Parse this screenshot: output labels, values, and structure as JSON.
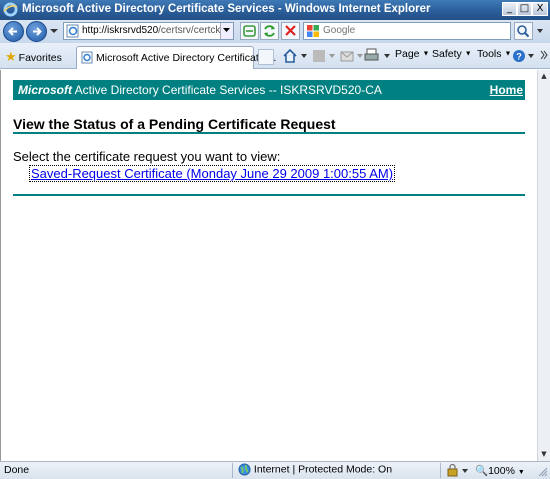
{
  "window": {
    "title": "Microsoft Active Directory Certificate Services - Windows Internet Explorer",
    "min_glyph": "_",
    "max_glyph": "□",
    "close_glyph": "X"
  },
  "addressbar": {
    "url_host": "http://iskrsrvd520",
    "url_path": "/certsrv/certckpn",
    "icons": [
      "ie-page-icon",
      "compatibility-view-icon",
      "refresh-icon",
      "stop-icon"
    ]
  },
  "searchbox": {
    "placeholder": "Google"
  },
  "tabs": {
    "favorites_label": "Favorites",
    "active_tab_label": "Microsoft Active Directory Certificate ..."
  },
  "commandbar": {
    "page_label": "Page",
    "safety_label": "Safety",
    "tools_label": "Tools"
  },
  "page": {
    "brand_italic": "Microsoft",
    "brand_rest": " Active Directory Certificate Services  --  ISKRSRVD520-CA",
    "home_link": "Home",
    "title": "View the Status of a Pending Certificate Request",
    "prompt": "Select the certificate request you want to view:",
    "requests": [
      "Saved-Request Certificate (Monday June 29 2009 1:00:55 AM)"
    ],
    "accent_color": "#008080"
  },
  "statusbar": {
    "status": "Done",
    "zone": "Internet | Protected Mode: On",
    "zoom": "100%"
  }
}
